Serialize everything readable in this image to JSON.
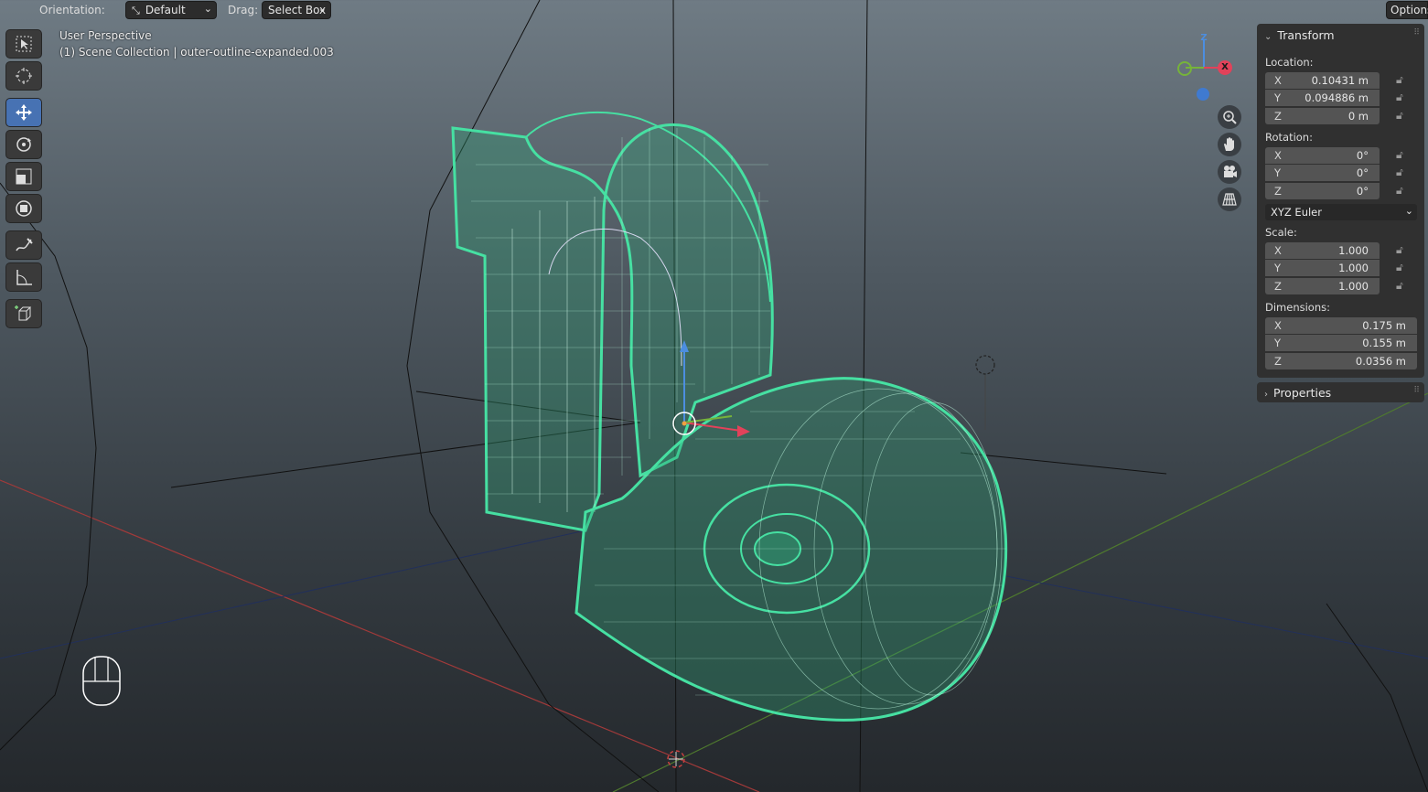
{
  "header": {
    "orientation_label": "Orientation:",
    "orientation_value": "Default",
    "drag_label": "Drag:",
    "drag_value": "Select Box",
    "options_label": "Options"
  },
  "viewport": {
    "view_name": "User Perspective",
    "collection_info": "(1) Scene Collection | outer-outline-expanded.003",
    "object_wire_color": "#3fd99a"
  },
  "toolbar": {
    "tools": [
      {
        "name": "select-box-tool",
        "icon": "select-box-icon"
      },
      {
        "name": "cursor-tool",
        "icon": "cursor-icon"
      },
      {
        "name": "move-tool",
        "icon": "move-icon",
        "active": true
      },
      {
        "name": "rotate-tool",
        "icon": "rotate-icon"
      },
      {
        "name": "scale-tool",
        "icon": "scale-icon"
      },
      {
        "name": "transform-tool",
        "icon": "transform-icon"
      },
      {
        "name": "annotate-tool",
        "icon": "annotate-icon"
      },
      {
        "name": "measure-tool",
        "icon": "measure-icon"
      },
      {
        "name": "add-cube-tool",
        "icon": "add-cube-icon"
      }
    ]
  },
  "gizmo": {
    "z_label": "Z",
    "x_label": "X",
    "x_color": "#e2425a",
    "y_color": "#76b33a",
    "z_color": "#4c8ee0"
  },
  "transform": {
    "title": "Transform",
    "location_label": "Location:",
    "location": [
      {
        "axis": "X",
        "value": "0.10431 m"
      },
      {
        "axis": "Y",
        "value": "0.094886 m"
      },
      {
        "axis": "Z",
        "value": "0 m"
      }
    ],
    "rotation_label": "Rotation:",
    "rotation": [
      {
        "axis": "X",
        "value": "0°"
      },
      {
        "axis": "Y",
        "value": "0°"
      },
      {
        "axis": "Z",
        "value": "0°"
      }
    ],
    "rotation_mode": "XYZ Euler",
    "scale_label": "Scale:",
    "scale": [
      {
        "axis": "X",
        "value": "1.000"
      },
      {
        "axis": "Y",
        "value": "1.000"
      },
      {
        "axis": "Z",
        "value": "1.000"
      }
    ],
    "dimensions_label": "Dimensions:",
    "dimensions": [
      {
        "axis": "X",
        "value": "0.175 m"
      },
      {
        "axis": "Y",
        "value": "0.155 m"
      },
      {
        "axis": "Z",
        "value": "0.0356 m"
      }
    ]
  },
  "properties": {
    "title": "Properties"
  }
}
